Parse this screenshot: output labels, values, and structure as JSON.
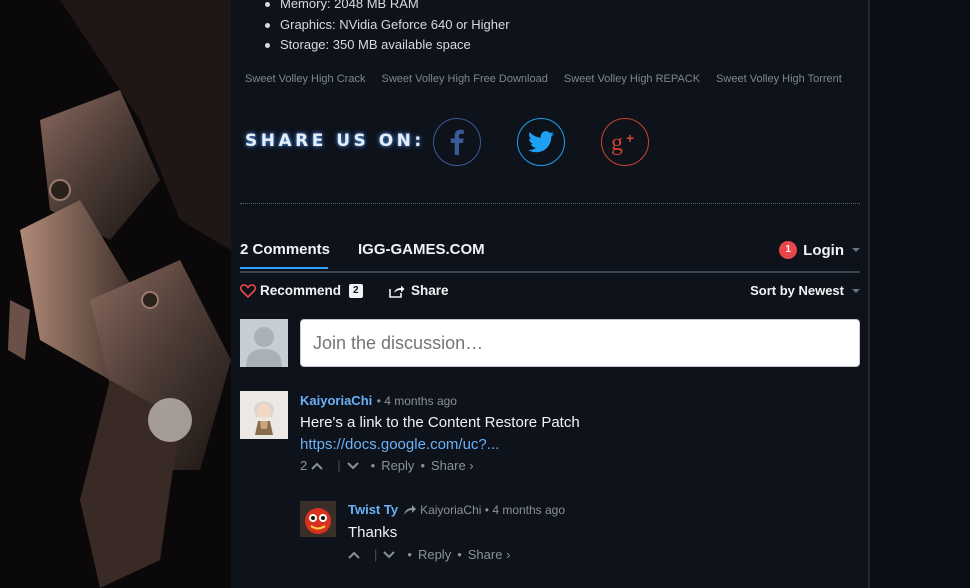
{
  "specs": [
    "Memory: 2048 MB RAM",
    "Graphics: NVidia Geforce 640 or Higher",
    "Storage: 350 MB available space"
  ],
  "tags": [
    "Sweet Volley High Crack",
    "Sweet Volley High Free Download",
    "Sweet Volley High REPACK",
    "Sweet Volley High Torrent"
  ],
  "share": {
    "label": "SHARE US ON:",
    "icons": [
      "facebook-icon",
      "twitter-icon",
      "google-plus-icon"
    ]
  },
  "disqus": {
    "tab_comments": "2 Comments",
    "tab_site": "IGG-GAMES.COM",
    "login_badge": "1",
    "login_label": "Login",
    "recommend_label": "Recommend",
    "recommend_count": "2",
    "share_label": "Share",
    "sort_label": "Sort by Newest",
    "input_placeholder": "Join the discussion…"
  },
  "comments": [
    {
      "author": "KaiyoriaChi",
      "time": "4 months ago",
      "text": "Here's a link to the Content Restore Patch",
      "link": "https://docs.google.com/uc?...",
      "votes": "2",
      "reply": "Reply",
      "share": "Share ›"
    },
    {
      "author": "Twist Ty",
      "reply_to": "KaiyoriaChi",
      "time": "4 months ago",
      "text": "Thanks",
      "reply": "Reply",
      "share": "Share ›"
    }
  ],
  "colors": {
    "accent": "#2e9fff",
    "author": "#6ab2f7",
    "badge": "#e8464b",
    "bg": "#0e121a"
  }
}
